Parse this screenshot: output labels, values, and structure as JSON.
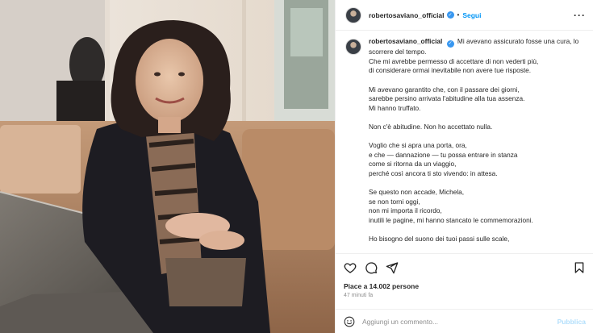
{
  "post": {
    "username": "robertosaviano_official",
    "follow_label": "Segui",
    "separator": "•",
    "more_icon": "more-dots-icon",
    "caption_first_line": "Mi avevano assicurato fosse una cura, lo",
    "caption_lines": [
      [
        "scorrere del tempo.",
        "Che mi avrebbe permesso di accettare di non vederti più,",
        "di considerare ormai inevitabile non avere tue risposte."
      ],
      [
        "Mi avevano garantito che, con il passare dei giorni,",
        "sarebbe persino arrivata l'abitudine alla tua assenza.",
        "Mi hanno truffato."
      ],
      [
        "Non c'è abitudine. Non ho accettato nulla."
      ],
      [
        "Voglio che si apra una porta, ora,",
        "e che — dannazione — tu possa entrare in stanza",
        "come si ritorna da un viaggio,",
        "perché così ancora ti sto vivendo: in attesa."
      ],
      [
        "Se questo non accade, Michela,",
        "se non torni oggi,",
        "non mi importa il ricordo,",
        "inutili le pagine, mi hanno stancato le commemorazioni."
      ],
      [
        "Ho bisogno del suono dei tuoi passi sulle scale,"
      ]
    ],
    "likes": "Piace a 14.002 persone",
    "time": "47 minuti fa",
    "comment_placeholder": "Aggiungi un commento...",
    "publish_label": "Pubblica"
  },
  "colors": {
    "link_blue": "#0095f6",
    "verified_blue": "#3897f0",
    "publish_disabled": "#b2dffc"
  }
}
